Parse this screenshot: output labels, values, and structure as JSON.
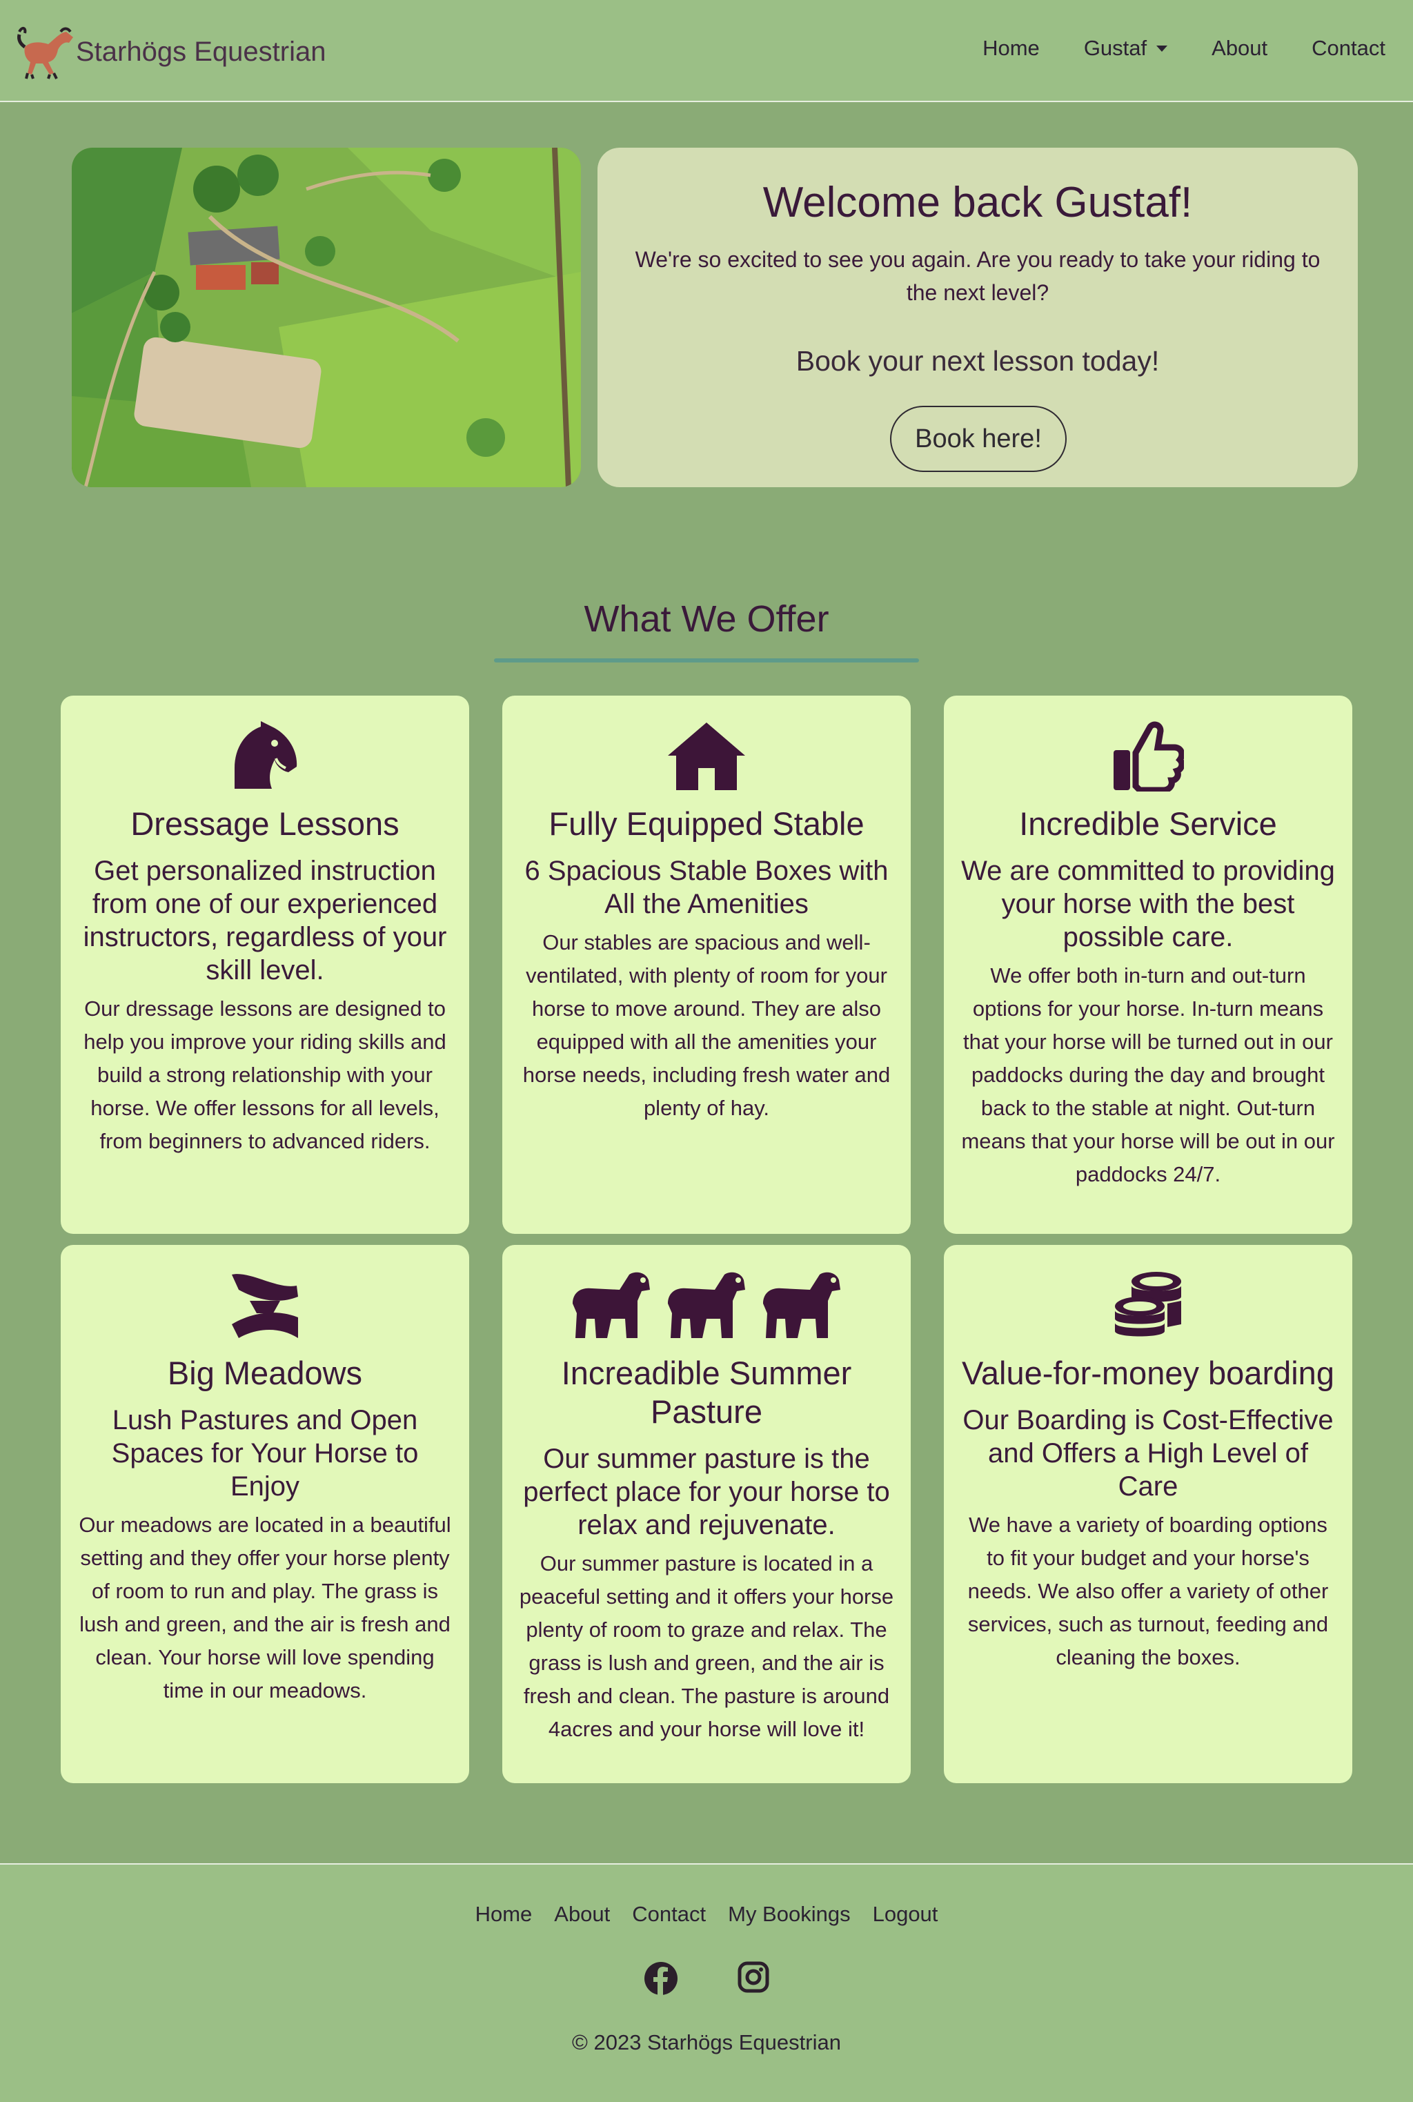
{
  "brand": {
    "name": "Starhögs Equestrian",
    "logo_icon": "horse-logo-icon"
  },
  "nav": {
    "home": "Home",
    "user": "Gustaf",
    "about": "About",
    "contact": "Contact"
  },
  "hero": {
    "image_alt": "Aerial view of the farm",
    "title": "Welcome back Gustaf!",
    "text": "We're so excited to see you again. Are you ready to take your riding to the next level?",
    "cta": "Book your next lesson today!",
    "button": "Book here!"
  },
  "offer": {
    "title": "What We Offer",
    "cards": [
      {
        "icon": "chess-knight-icon",
        "title": "Dressage Lessons",
        "subtitle": "Get personalized instruction from one of our experienced instructors, regardless of your skill level.",
        "text": "Our dressage lessons are designed to help you improve your riding skills and build a strong relationship with your horse. We offer lessons for all levels, from beginners to advanced riders."
      },
      {
        "icon": "house-icon",
        "title": "Fully Equipped Stable",
        "subtitle": "6 Spacious Stable Boxes with All the Amenities",
        "text": "Our stables are spacious and well-ventilated, with plenty of room for your horse to move around. They are also equipped with all the amenities your horse needs, including fresh water and plenty of hay."
      },
      {
        "icon": "thumbs-up-icon",
        "title": "Incredible Service",
        "subtitle": "We are committed to providing your horse with the best possible care.",
        "text": "We offer both in-turn and out-turn options for your horse. In-turn means that your horse will be turned out in our paddocks during the day and brought back to the stable at night. Out-turn means that your horse will be out in our paddocks 24/7."
      },
      {
        "icon": "confluence-icon",
        "title": "Big Meadows",
        "subtitle": "Lush Pastures and Open Spaces for Your Horse to Enjoy",
        "text": "Our meadows are located in a beautiful setting and they offer your horse plenty of room to run and play. The grass is lush and green, and the air is fresh and clean. Your horse will love spending time in our meadows."
      },
      {
        "icon": "horse-icon",
        "title": "Increadible Summer Pasture",
        "subtitle": "Our summer pasture is the perfect place for your horse to relax and rejuvenate.",
        "text": "Our summer pasture is located in a peaceful setting and it offers your horse plenty of room to graze and relax. The grass is lush and green, and the air is fresh and clean. The pasture is around 4acres and your horse will love it!"
      },
      {
        "icon": "coins-icon",
        "title": "Value-for-money boarding",
        "subtitle": "Our Boarding is Cost-Effective and Offers a High Level of Care",
        "text": "We have a variety of boarding options to fit your budget and your horse's needs. We also offer a variety of other services, such as turnout, feeding and cleaning the boxes."
      }
    ]
  },
  "footer": {
    "links": [
      "Home",
      "About",
      "Contact",
      "My Bookings",
      "Logout"
    ],
    "social": [
      "facebook-icon",
      "instagram-icon"
    ],
    "copyright": "© 2023 Starhögs Equestrian"
  },
  "colors": {
    "navbar": "#9bbf86",
    "page": "#8aab76",
    "card": "#e2f8b9",
    "welcome": "#d3ddb3",
    "icon": "#3d1538",
    "accent": "#5e9b8a"
  }
}
